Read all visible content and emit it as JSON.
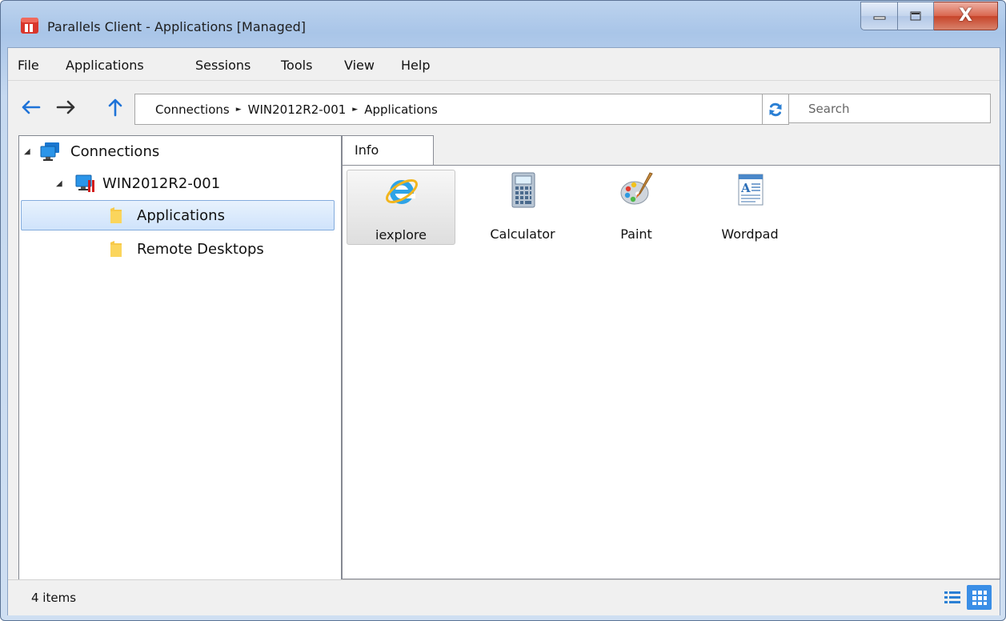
{
  "window": {
    "title": "Parallels Client - Applications [Managed]",
    "close_glyph": "X"
  },
  "menu": [
    "File",
    "Applications",
    "Sessions",
    "Tools",
    "View",
    "Help"
  ],
  "toolbar": {
    "breadcrumb": [
      "Connections",
      "WIN2012R2-001",
      "Applications"
    ],
    "breadcrumb_separator": "►",
    "search_placeholder": "Search"
  },
  "tree": {
    "root": {
      "label": "Connections",
      "expanded": true,
      "icon": "monitor-icon"
    },
    "server": {
      "label": "WIN2012R2-001",
      "expanded": true,
      "icon": "server-monitor-icon"
    },
    "folders": [
      {
        "label": "Applications",
        "selected": true,
        "icon": "folder-icon"
      },
      {
        "label": "Remote Desktops",
        "selected": false,
        "icon": "folder-icon"
      }
    ]
  },
  "tabs": [
    {
      "label": "Info"
    }
  ],
  "apps": [
    {
      "label": "iexplore",
      "icon": "internet-explorer-icon",
      "selected": true
    },
    {
      "label": "Calculator",
      "icon": "calculator-icon",
      "selected": false
    },
    {
      "label": "Paint",
      "icon": "paint-palette-icon",
      "selected": false
    },
    {
      "label": "Wordpad",
      "icon": "wordpad-icon",
      "selected": false
    }
  ],
  "status": {
    "text": "4 items"
  },
  "colors": {
    "title_bar": "#a9c5e8",
    "selection_blue": "#cfe3fb",
    "nav_arrow_blue": "#1e73d8",
    "close_red": "#c7442a",
    "active_view": "#3a8ee6"
  }
}
